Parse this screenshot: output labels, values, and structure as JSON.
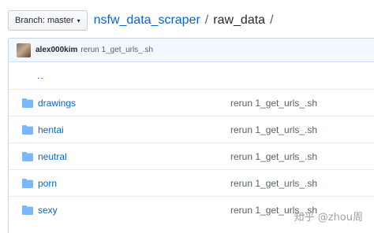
{
  "header": {
    "branch_label": "Branch: master",
    "branch_caret": "▾",
    "repo": "nsfw_data_scraper",
    "separator": "/",
    "folder": "raw_data",
    "trailing_separator": "/"
  },
  "commit": {
    "author": "alex000kim",
    "message": "rerun 1_get_urls_.sh"
  },
  "parent": {
    "label": ".."
  },
  "files": [
    {
      "name": "drawings",
      "message": "rerun 1_get_urls_.sh",
      "icon": "folder-icon"
    },
    {
      "name": "hentai",
      "message": "rerun 1_get_urls_.sh",
      "icon": "folder-icon"
    },
    {
      "name": "neutral",
      "message": "rerun 1_get_urls_.sh",
      "icon": "folder-icon"
    },
    {
      "name": "porn",
      "message": "rerun 1_get_urls_.sh",
      "icon": "folder-icon"
    },
    {
      "name": "sexy",
      "message": "rerun 1_get_urls_.sh",
      "icon": "folder-icon"
    }
  ],
  "watermark": "知乎 @zhou周",
  "colors": {
    "link": "#0366d6",
    "folder": "#79b8ff",
    "commit_bg": "#f1f8ff"
  }
}
